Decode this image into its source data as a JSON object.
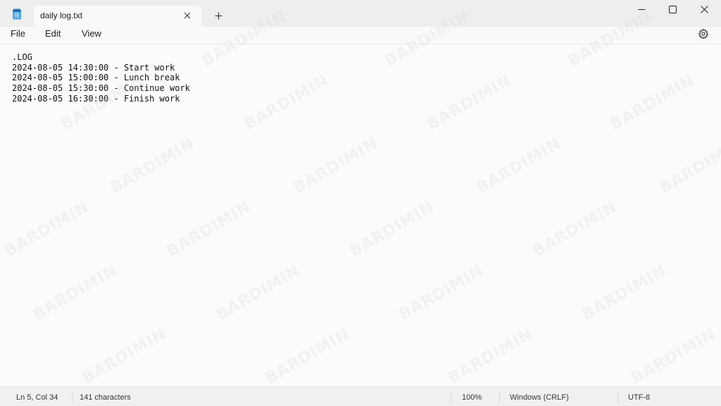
{
  "window": {
    "tab_title": "daily log.txt",
    "new_tab_label": "+"
  },
  "menu": {
    "file": "File",
    "edit": "Edit",
    "view": "View"
  },
  "editor": {
    "lines": [
      ".LOG",
      "2024-08-05 14:30:00 - Start work",
      "2024-08-05 15:00:00 - Lunch break",
      "2024-08-05 15:30:00 - Continue work",
      "2024-08-05 16:30:00 - Finish work"
    ]
  },
  "status": {
    "position": "Ln 5, Col 34",
    "characters": "141 characters",
    "zoom": "100%",
    "line_ending": "Windows (CRLF)",
    "encoding": "UTF-8"
  },
  "watermark": {
    "text": "BARDIMIN"
  },
  "icons": {
    "app": "notepad-icon",
    "tab_close": "close-icon",
    "new_tab": "plus-icon",
    "minimize": "minimize-icon",
    "maximize": "maximize-icon",
    "close": "close-icon",
    "settings": "gear-icon"
  }
}
